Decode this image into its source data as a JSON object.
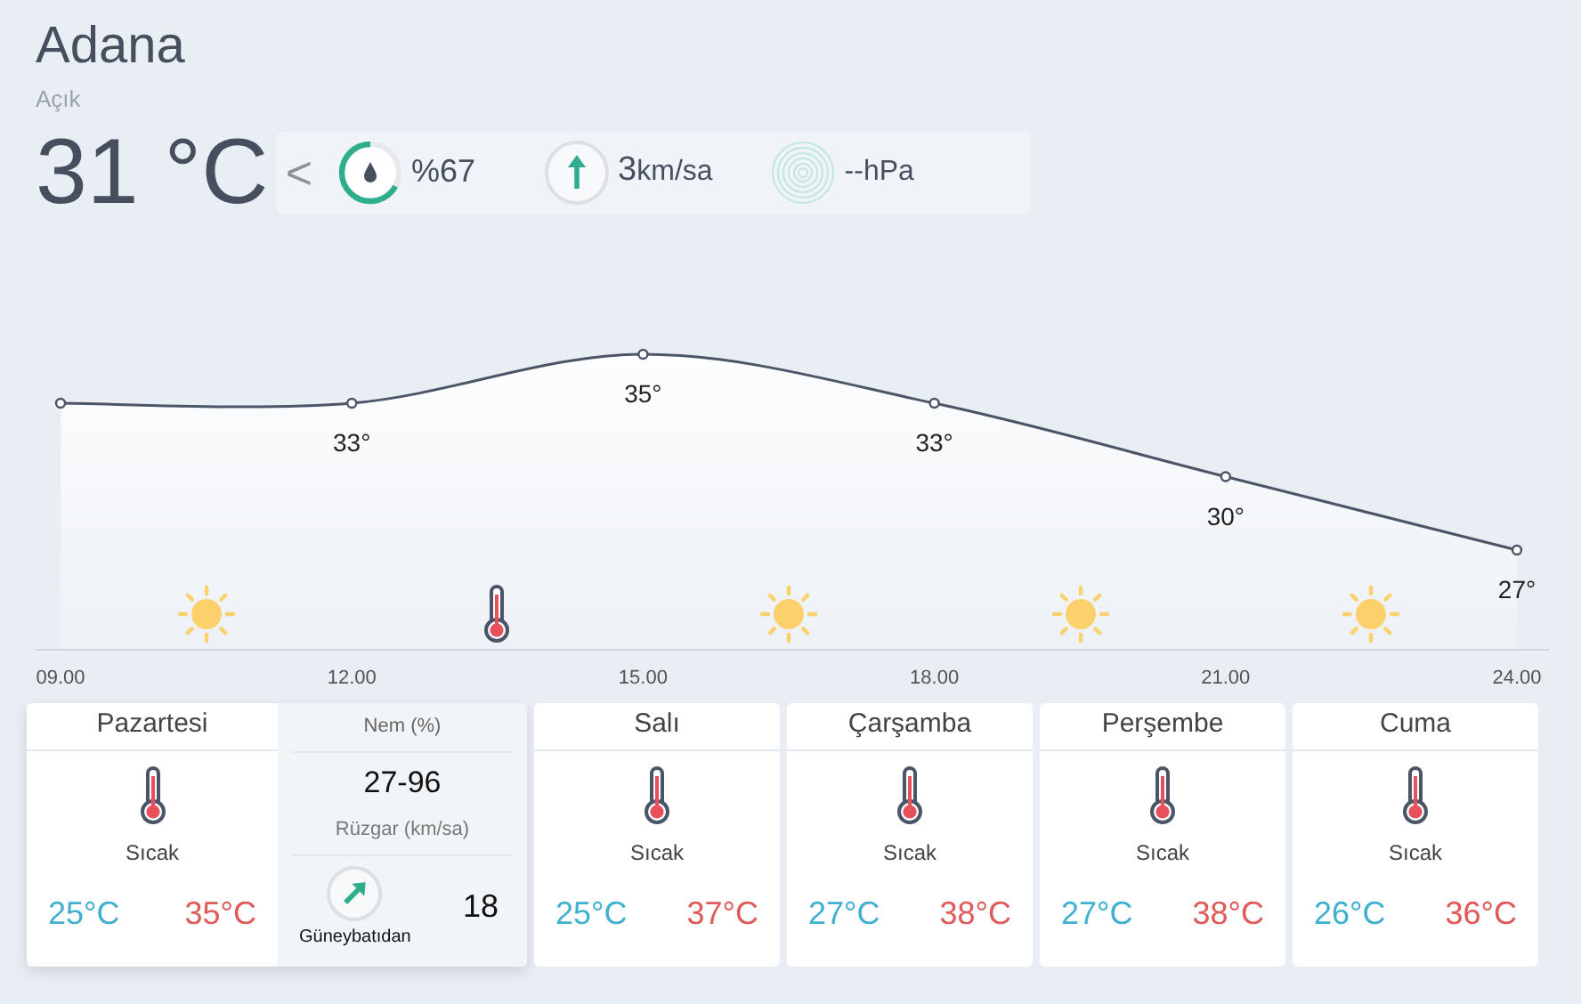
{
  "location": {
    "city": "Adana",
    "condition": "Açık",
    "temperature": "31 °C"
  },
  "current": {
    "back": "<",
    "humidity": {
      "value": "%67"
    },
    "wind": {
      "value": "3",
      "unit": "km/sa"
    },
    "pressure": {
      "value": "--hPa"
    }
  },
  "hourly": {
    "chart_data": {
      "type": "area",
      "marker": "o",
      "categories": [
        "09.00",
        "12.00",
        "15.00",
        "18.00",
        "21.00",
        "24.00"
      ],
      "values": [
        33,
        33,
        35,
        33,
        30,
        27
      ],
      "value_labels": [
        null,
        "33°",
        "35°",
        "33°",
        "30°",
        "27°"
      ]
    },
    "icons": [
      {
        "kind": "sun"
      },
      {
        "kind": "thermometer"
      },
      {
        "kind": "sun"
      },
      {
        "kind": "sun"
      },
      {
        "kind": "sun"
      }
    ]
  },
  "days": [
    {
      "name": "Pazartesi",
      "selected": true,
      "condition": "Sıcak",
      "low": "25°C",
      "high": "35°C",
      "details": {
        "humidity_label": "Nem (%)",
        "humidity": "27-96",
        "wind_label": "Rüzgar (km/sa)",
        "wind_direction": "Güneybatıdan",
        "wind_speed": "18"
      }
    },
    {
      "name": "Salı",
      "selected": false,
      "condition": "Sıcak",
      "low": "25°C",
      "high": "37°C"
    },
    {
      "name": "Çarşamba",
      "selected": false,
      "condition": "Sıcak",
      "low": "27°C",
      "high": "38°C"
    },
    {
      "name": "Perşembe",
      "selected": false,
      "condition": "Sıcak",
      "low": "27°C",
      "high": "38°C"
    },
    {
      "name": "Cuma",
      "selected": false,
      "condition": "Sıcak",
      "low": "26°C",
      "high": "36°C"
    }
  ]
}
